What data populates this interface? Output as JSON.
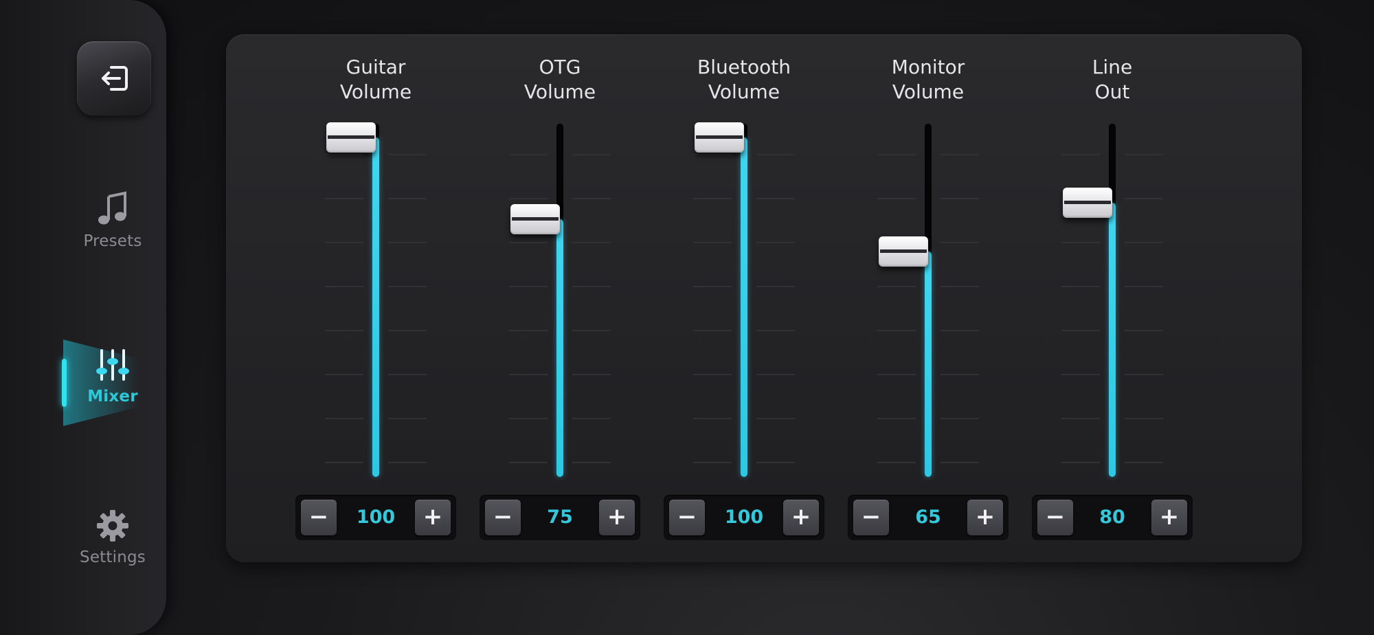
{
  "sidebar": {
    "exit_icon": "exit-icon",
    "items": [
      {
        "id": "presets",
        "label": "Presets",
        "icon": "music-note-icon",
        "active": false
      },
      {
        "id": "mixer",
        "label": "Mixer",
        "icon": "mixer-sliders-icon",
        "active": true
      },
      {
        "id": "settings",
        "label": "Settings",
        "icon": "gear-icon",
        "active": false
      }
    ]
  },
  "mixer": {
    "channels": [
      {
        "id": "guitar",
        "label_line1": "Guitar",
        "label_line2": "Volume",
        "value": 100,
        "value_text": "100"
      },
      {
        "id": "otg",
        "label_line1": "OTG",
        "label_line2": "Volume",
        "value": 75,
        "value_text": "75"
      },
      {
        "id": "bluetooth",
        "label_line1": "Bluetooth",
        "label_line2": "Volume",
        "value": 100,
        "value_text": "100"
      },
      {
        "id": "monitor",
        "label_line1": "Monitor",
        "label_line2": "Volume",
        "value": 65,
        "value_text": "65"
      },
      {
        "id": "line-out",
        "label_line1": "Line",
        "label_line2": "Out",
        "value": 80,
        "value_text": "80"
      }
    ],
    "minus_label": "−",
    "plus_label": "+"
  },
  "colors": {
    "accent": "#2ec9d8",
    "fill": "#3fd6f0",
    "panel": "#252528",
    "sidebar": "#202023"
  }
}
